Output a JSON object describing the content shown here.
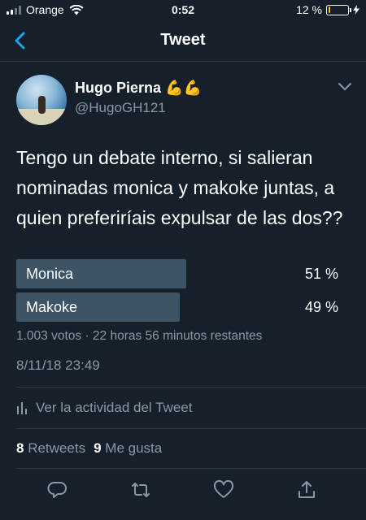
{
  "status_bar": {
    "carrier": "Orange",
    "time": "0:52",
    "battery": "12 %",
    "battery_level": 0.12
  },
  "nav": {
    "title": "Tweet"
  },
  "author": {
    "name": "Hugo Pierna",
    "emoji": "💪💪",
    "handle": "@HugoGH121"
  },
  "tweet": {
    "lines": [
      "Tengo un debate interno, si salieran",
      "nominadas monica y makoke juntas, a",
      "quien preferiríais expulsar de las dos??"
    ]
  },
  "poll": {
    "options": [
      {
        "label": "Monica",
        "percent": "51 %",
        "share": 0.51
      },
      {
        "label": "Makoke",
        "percent": "49 %",
        "share": 0.49
      }
    ],
    "meta": "1.003 votos · 22 horas 56 minutos restantes"
  },
  "timestamp": "8/11/18 23:49",
  "activity_label": "Ver la actividad del Tweet",
  "stats": {
    "retweets_count": "8",
    "retweets_label": "Retweets",
    "likes_count": "9",
    "likes_label": "Me gusta"
  },
  "colors": {
    "background": "#15202b",
    "accent": "#1da1f2",
    "poll_bar": "#3d5466",
    "muted": "#8899a6"
  }
}
